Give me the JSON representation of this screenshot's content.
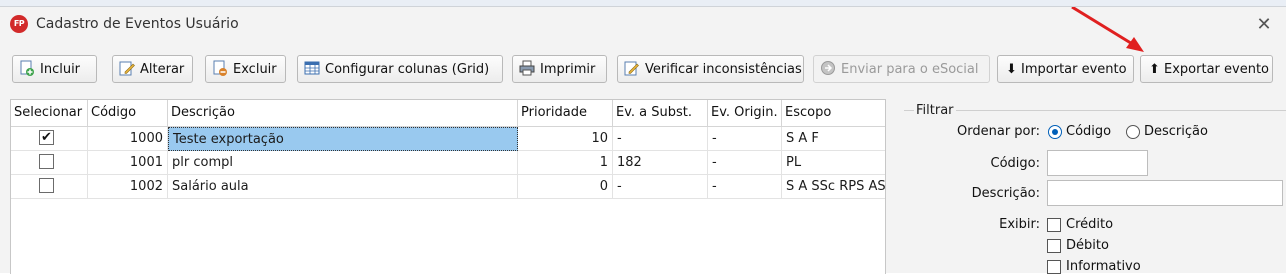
{
  "window": {
    "title": "Cadastro de Eventos Usuário",
    "app_badge": "FP"
  },
  "toolbar": {
    "incluir": "Incluir",
    "alterar": "Alterar",
    "excluir": "Excluir",
    "configurar": "Configurar colunas (Grid)",
    "imprimir": "Imprimir",
    "verificar": "Verificar inconsistências",
    "enviar": "Enviar para o eSocial",
    "importar": "⬇ Importar evento",
    "exportar": "⬆ Exportar evento"
  },
  "grid": {
    "headers": [
      "Selecionar",
      "Código",
      "Descrição",
      "Prioridade",
      "Ev. a Subst.",
      "Ev. Origin.",
      "Escopo"
    ],
    "rows": [
      {
        "checked": true,
        "check_glyph": "✔",
        "codigo": "1000",
        "descricao": "Teste exportação",
        "prioridade": "10",
        "ev_subst": "-",
        "ev_origin": "-",
        "escopo": "S A F"
      },
      {
        "checked": false,
        "check_glyph": "",
        "codigo": "1001",
        "descricao": "plr compl",
        "prioridade": "1",
        "ev_subst": "182",
        "ev_origin": "-",
        "escopo": "PL"
      },
      {
        "checked": false,
        "check_glyph": "",
        "codigo": "1002",
        "descricao": "Salário aula",
        "prioridade": "0",
        "ev_subst": "-",
        "ev_origin": "-",
        "escopo": "S A SSc RPS AS"
      }
    ]
  },
  "filter": {
    "legend": "Filtrar",
    "ordenar_label": "Ordenar por:",
    "ordenar_options": [
      "Código",
      "Descrição"
    ],
    "ordenar_selected": "Código",
    "codigo_label": "Código:",
    "codigo_value": "",
    "descricao_label": "Descrição:",
    "descricao_value": "",
    "exibir_label": "Exibir:",
    "exibir_options": [
      "Crédito",
      "Débito",
      "Informativo"
    ]
  },
  "colors": {
    "selection": "#99c9ef",
    "accent": "#005fb8",
    "annotation_arrow": "#e02020"
  }
}
